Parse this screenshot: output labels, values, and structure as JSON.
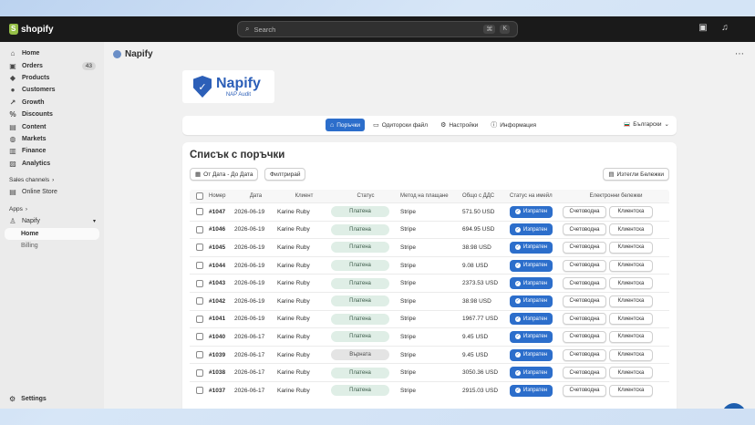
{
  "topbar": {
    "logo_text": "shopify",
    "search_placeholder": "Search",
    "shortcut_cmd": "⌘",
    "shortcut_key": "K"
  },
  "sidebar": {
    "items": [
      {
        "label": "Home",
        "icon": "home-icon"
      },
      {
        "label": "Orders",
        "icon": "orders-icon",
        "badge": "43"
      },
      {
        "label": "Products",
        "icon": "products-icon"
      },
      {
        "label": "Customers",
        "icon": "customers-icon"
      },
      {
        "label": "Growth",
        "icon": "growth-icon"
      },
      {
        "label": "Discounts",
        "icon": "discounts-icon"
      },
      {
        "label": "Content",
        "icon": "content-icon"
      },
      {
        "label": "Markets",
        "icon": "markets-icon"
      },
      {
        "label": "Finance",
        "icon": "finance-icon"
      },
      {
        "label": "Analytics",
        "icon": "analytics-icon"
      }
    ],
    "sales_channels_title": "Sales channels",
    "online_store": "Online Store",
    "apps_title": "Apps",
    "app_name": "Napify",
    "app_sub_home": "Home",
    "app_sub_billing": "Billing",
    "settings": "Settings"
  },
  "main": {
    "app_title": "Napify",
    "brand_name": "Napify",
    "brand_sub": "NAP Audit",
    "tabs": [
      {
        "label": "Поръчки",
        "active": true
      },
      {
        "label": "Одиторски файл",
        "active": false
      },
      {
        "label": "Настройки",
        "active": false
      },
      {
        "label": "Информация",
        "active": false
      }
    ],
    "language": "Български",
    "orders_title": "Списък с поръчки",
    "date_filter": "От Дата - До Дата",
    "filter_button": "Филтрирай",
    "delete_notes_button": "Изтегли Бележки",
    "columns": [
      "Номер",
      "Дата",
      "Клиент",
      "Статус",
      "Метод на плащане",
      "Общо с ДДС",
      "Статус на имейл",
      "Електронни бележки"
    ],
    "rows": [
      {
        "num": "#1047",
        "date": "2026-06-19",
        "client": "Karine Ruby",
        "status": "Платена",
        "status_type": "paid",
        "method": "Stripe",
        "total": "571.50 USD",
        "email": "Изпратен"
      },
      {
        "num": "#1046",
        "date": "2026-06-19",
        "client": "Karine Ruby",
        "status": "Платена",
        "status_type": "paid",
        "method": "Stripe",
        "total": "694.95 USD",
        "email": "Изпратен"
      },
      {
        "num": "#1045",
        "date": "2026-06-19",
        "client": "Karine Ruby",
        "status": "Платена",
        "status_type": "paid",
        "method": "Stripe",
        "total": "38.98 USD",
        "email": "Изпратен"
      },
      {
        "num": "#1044",
        "date": "2026-06-19",
        "client": "Karine Ruby",
        "status": "Платена",
        "status_type": "paid",
        "method": "Stripe",
        "total": "9.08 USD",
        "email": "Изпратен"
      },
      {
        "num": "#1043",
        "date": "2026-06-19",
        "client": "Karine Ruby",
        "status": "Платена",
        "status_type": "paid",
        "method": "Stripe",
        "total": "2373.53 USD",
        "email": "Изпратен"
      },
      {
        "num": "#1042",
        "date": "2026-06-19",
        "client": "Karine Ruby",
        "status": "Платена",
        "status_type": "paid",
        "method": "Stripe",
        "total": "38.98 USD",
        "email": "Изпратен"
      },
      {
        "num": "#1041",
        "date": "2026-06-19",
        "client": "Karine Ruby",
        "status": "Платена",
        "status_type": "paid",
        "method": "Stripe",
        "total": "1967.77 USD",
        "email": "Изпратен"
      },
      {
        "num": "#1040",
        "date": "2026-06-17",
        "client": "Karine Ruby",
        "status": "Платена",
        "status_type": "paid",
        "method": "Stripe",
        "total": "9.45 USD",
        "email": "Изпратен"
      },
      {
        "num": "#1039",
        "date": "2026-06-17",
        "client": "Karine Ruby",
        "status": "Върната",
        "status_type": "returned",
        "method": "Stripe",
        "total": "9.45 USD",
        "email": "Изпратен"
      },
      {
        "num": "#1038",
        "date": "2026-06-17",
        "client": "Karine Ruby",
        "status": "Платена",
        "status_type": "paid",
        "method": "Stripe",
        "total": "3050.36 USD",
        "email": "Изпратен"
      },
      {
        "num": "#1037",
        "date": "2026-06-17",
        "client": "Karine Ruby",
        "status": "Платена",
        "status_type": "paid",
        "method": "Stripe",
        "total": "2915.03 USD",
        "email": "Изпратен"
      }
    ],
    "note_buttons": [
      "Счетоводна",
      "Клиентска"
    ]
  },
  "colors": {
    "accent": "#2c6ecb",
    "paid_bg": "#dfeee6",
    "returned_bg": "#e4e4e4"
  }
}
